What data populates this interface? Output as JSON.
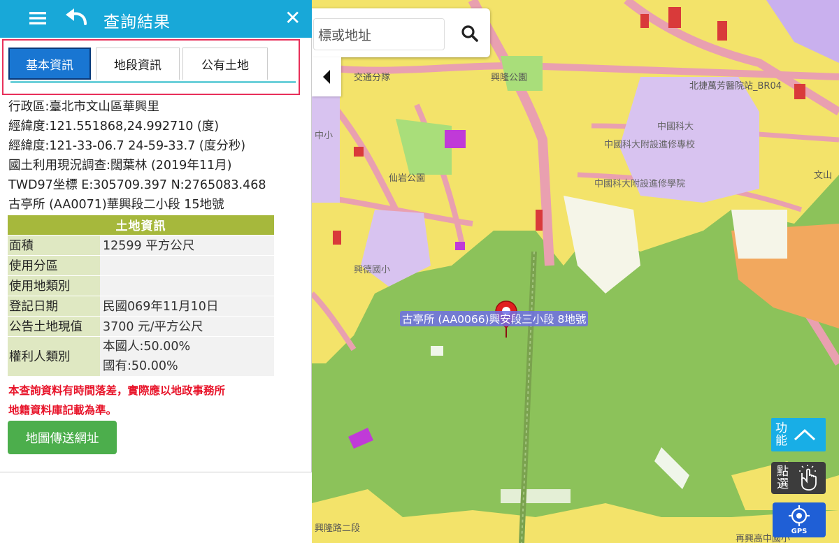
{
  "header": {
    "title": "查詢結果",
    "close_label": "✕"
  },
  "tabs": [
    {
      "label": "基本資訊",
      "active": true
    },
    {
      "label": "地段資訊",
      "active": false
    },
    {
      "label": "公有土地",
      "active": false
    }
  ],
  "info": {
    "district": "行政區:臺北市文山區華興里",
    "latlng_deg": "經緯度:121.551868,24.992710 (度)",
    "latlng_dms": "經緯度:121-33-06.7 24-59-33.7 (度分秒)",
    "land_use": "國土利用現況調查:闊葉林 (2019年11月)",
    "twd97": "TWD97坐標 E:305709.397 N:2765083.468",
    "parcel": "古亭所 (AA0071)華興段二小段 15地號"
  },
  "land_table": {
    "title": "土地資訊",
    "rows": [
      {
        "key": "面積",
        "value": "12599 平方公尺"
      },
      {
        "key": "使用分區",
        "value": ""
      },
      {
        "key": "使用地類別",
        "value": ""
      },
      {
        "key": "登記日期",
        "value": "民國069年11月10日"
      },
      {
        "key": "公告土地現值",
        "value": "3700 元/平方公尺"
      }
    ],
    "owner": {
      "key": "權利人類別",
      "values": [
        "本國人:50.00%",
        "國有:50.00%"
      ]
    }
  },
  "warning": {
    "line1": "本查詢資料有時間落差，實際應以地政事務所",
    "line2": "地籍資料庫記載為準。"
  },
  "send_button": "地圖傳送網址",
  "search": {
    "value": "標或地址"
  },
  "map": {
    "parcel_label": "古亭所 (AA0066)興安段三小段 8地號",
    "labels": {
      "l1": "交通分隊",
      "l2": "興隆公園",
      "l3": "北捷萬芳醫院站_BR04",
      "l4": "中國科大",
      "l5": "中國科大附設進修專校",
      "l6": "中國科大附設進修學院",
      "l7": "仙岩公園",
      "l8": "興德國小",
      "l9": "文山",
      "l10": "中小",
      "l11": "再興高中國小",
      "l12": "興隆路二段"
    }
  },
  "controls": {
    "function_label": "功能",
    "click_label": "點選",
    "gps_label": "GPS"
  },
  "colors": {
    "header_bg": "#18a8d8",
    "tab_active": "#1976d2",
    "table_header": "#a6b83c",
    "warning_text": "#e8142a",
    "send_button": "#4cae4c",
    "map_green": "#8cc25a",
    "map_yellow": "#f5e86a",
    "map_purple": "#d8c3f0"
  },
  "icons": {
    "menu": "hamburger-icon",
    "back": "undo-arrow-icon",
    "close": "close-icon",
    "search": "magnifier-icon",
    "collapse": "caret-left-icon",
    "function": "chevron-up-icon",
    "click": "tap-hand-icon",
    "gps": "crosshair-icon",
    "pin": "map-pin-icon"
  }
}
